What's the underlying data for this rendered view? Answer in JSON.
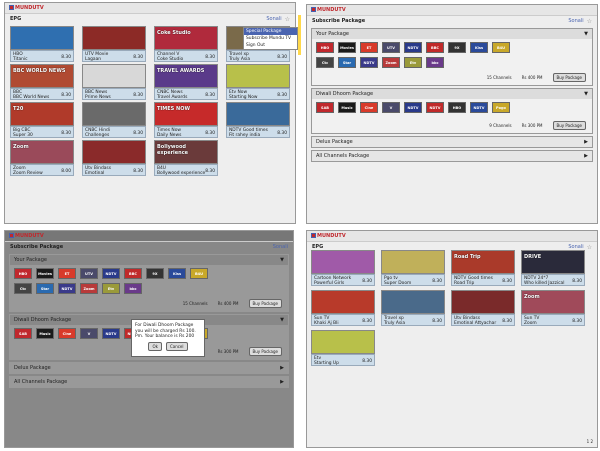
{
  "logo": "MUNDUTV",
  "user": "Sonali",
  "s1": {
    "title": "EPG",
    "tiles": [
      {
        "ch": "HBO",
        "show": "Titanic",
        "time": "8.30",
        "img": "#2f6fb0"
      },
      {
        "ch": "UTV Movie",
        "show": "Lagaan",
        "time": "8.30",
        "img": "#8c2a26"
      },
      {
        "ch": "Channel V",
        "show": "Coke Studio",
        "time": "8.30",
        "img": "#b02a3c",
        "ovl": "Coke Studio"
      },
      {
        "ch": "Travel xp",
        "show": "Truly Asia",
        "time": "8.30",
        "img": "#7a6a4a"
      },
      {
        "ch": "BBC",
        "show": "BBC World News",
        "time": "8.30",
        "img": "#b04a32",
        "ovl": "BBC WORLD NEWS"
      },
      {
        "ch": "BBC News",
        "show": "Prime News",
        "time": "8.30",
        "img": "#d8d8d8"
      },
      {
        "ch": "CNBC News",
        "show": "Travel Awards",
        "time": "8.30",
        "img": "#5a3a8a",
        "ovl": "TRAVEL AWARDS"
      },
      {
        "ch": "Etv Now",
        "show": "Starting Now",
        "time": "8.30",
        "img": "#b8c04a"
      },
      {
        "ch": "Big CBC",
        "show": "Super 30",
        "time": "8.30",
        "img": "#b03a2a",
        "ovl": "T20"
      },
      {
        "ch": "CNBC Hindi",
        "show": "Challenges",
        "time": "8.30",
        "img": "#6a6a6a"
      },
      {
        "ch": "Times Now",
        "show": "Daily News",
        "time": "8.30",
        "img": "#c62a2a",
        "ovl": "TIMES NOW"
      },
      {
        "ch": "NDTV Good times",
        "show": "Fit rahey india",
        "time": "8.30",
        "img": "#3a6a9a"
      },
      {
        "ch": "Zoom",
        "show": "Zoom Review",
        "time": "8.00",
        "img": "#9a4a5a",
        "ovl": "Zoom"
      },
      {
        "ch": "Utv Bindass",
        "show": "Emotinal",
        "time": "8.30",
        "img": "#8a2a2a"
      },
      {
        "ch": "B4U",
        "show": "Bollywood experience",
        "time": "8.30",
        "img": "#6a3a3a",
        "ovl": "Bollywood experience"
      }
    ],
    "menu": [
      "Special Package",
      "Subscribe Mundu TV",
      "Sign Out"
    ]
  },
  "s2": {
    "title": "Subscribe Package",
    "your": {
      "label": "Your Package",
      "channels": [
        "HBO",
        "Movies",
        "ET",
        "UTV",
        "NDTV",
        "BBC",
        "9X",
        "Kiss",
        "B4U",
        "Ctc",
        "Star",
        "NDTV",
        "Zoom",
        "Etv",
        "bbc"
      ],
      "count": "15 Channels",
      "price": "Rs 400 PM",
      "btn": "Buy Package"
    },
    "diwali": {
      "label": "Diwali Dhoom Package",
      "channels": [
        "SAB",
        "Music",
        "Cine",
        "V",
        "NDTV",
        "NDTV",
        "HBO",
        "NDTV",
        "Pogo"
      ],
      "count": "9 Channels",
      "price": "Rs 300 PM",
      "btn": "Buy Package"
    },
    "delux": "Delux Package",
    "all": "All Channels Package"
  },
  "s3": {
    "dialog": "For Diwali Dhoom Package you will be charged Rs 100. Pm. Your balance is Rs 200",
    "ok": "Ok",
    "cancel": "Cancel"
  },
  "s4": {
    "title": "EPG",
    "tiles": [
      {
        "ch": "Cartoon Network",
        "show": "Powerful Girls",
        "time": "8.30",
        "img": "#a05aa8"
      },
      {
        "ch": "Pgo tv",
        "show": "Super Doom",
        "time": "8.30",
        "img": "#c0b05a"
      },
      {
        "ch": "NDTV Good times",
        "show": "Road Trip",
        "time": "8.30",
        "img": "#aa3a2a",
        "ovl": "Road Trip"
      },
      {
        "ch": "NDTV 24*7",
        "show": "Who killed Jazzical",
        "time": "8.30",
        "img": "#2a2a3a",
        "ovl": "DRIVE"
      },
      {
        "ch": "Sun TV",
        "show": "Khaki Aj Bli",
        "time": "8.30",
        "img": "#b83a2a"
      },
      {
        "ch": "Travel xp",
        "show": "Truly Asia",
        "time": "8.30",
        "img": "#4a6a8a"
      },
      {
        "ch": "Utv Bindass",
        "show": "Emotinal Attyachar",
        "time": "8.30",
        "img": "#7a2a2a"
      },
      {
        "ch": "Sun TV",
        "show": "Zoom",
        "time": "8.30",
        "img": "#a04a5a",
        "ovl": "Zoom"
      },
      {
        "ch": "Etv",
        "show": "Starting Up",
        "time": "8.30",
        "img": "#b8c04a"
      }
    ],
    "page": "1  2"
  }
}
